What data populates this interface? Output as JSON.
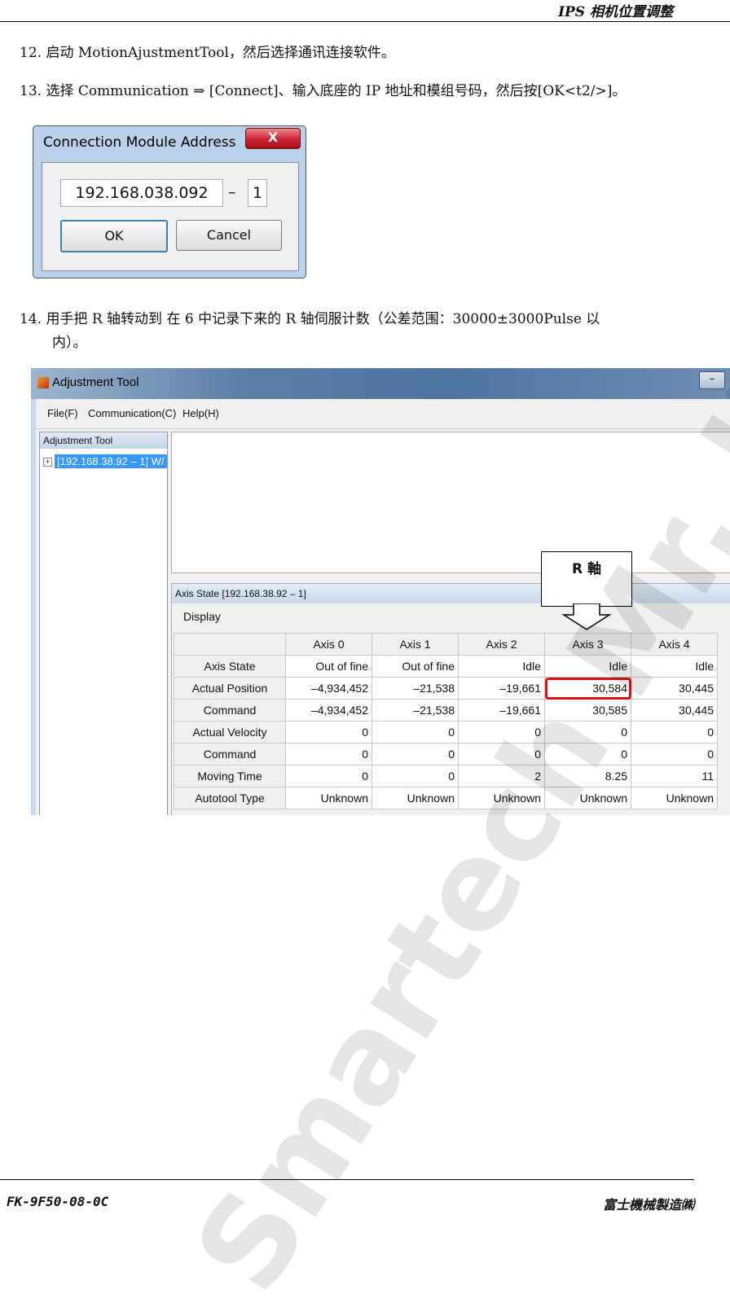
{
  "header": {
    "title": "IPS 相机位置调整"
  },
  "steps": {
    "s12": "12. 启动 MotionAjustmentTool，然后选择通讯连接软件。",
    "s13": "13. 选择 Communication ⇒ [Connect]、输入底座的 IP 地址和模组号码，然后按[OK<t2/>]。",
    "s14_line1": "14. 用手把 R 轴转动到 在 6 中记录下来的 R 轴伺服计数（公差范围：30000±3000Pulse 以",
    "s14_line2": "内）。"
  },
  "dialog": {
    "title": "Connection Module Address",
    "close_glyph": "X",
    "ip_value": "192.168.038.092",
    "dash": "–",
    "module_value": "1",
    "ok_label": "OK",
    "cancel_label": "Cancel"
  },
  "app": {
    "title": "Adjustment Tool",
    "minimize_glyph": "–",
    "menu": [
      "File(F)",
      "Communication(C)",
      "Help(H)"
    ],
    "tree_header": "Adjustment Tool",
    "tree_node": "[192.168.38.92 – 1] W/",
    "axis_pane_header": "Axis State [192.168.38.92 – 1]",
    "display_menu": "Display",
    "columns": [
      "",
      "Axis 0",
      "Axis 1",
      "Axis 2",
      "Axis 3",
      "Axis 4"
    ],
    "rows": [
      [
        "Axis State",
        "Out of fine",
        "Out of fine",
        "Idle",
        "Idle",
        "Idle"
      ],
      [
        "Actual Position",
        "–4,934,452",
        "–21,538",
        "–19,661",
        "30,584",
        "30,445"
      ],
      [
        "Command",
        "–4,934,452",
        "–21,538",
        "–19,661",
        "30,585",
        "30,445"
      ],
      [
        "Actual Velocity",
        "0",
        "0",
        "0",
        "0",
        "0"
      ],
      [
        "Command",
        "0",
        "0",
        "0",
        "0",
        "0"
      ],
      [
        "Moving Time",
        "0",
        "0",
        "2",
        "8.25",
        "11"
      ],
      [
        "Autotool Type",
        "Unknown",
        "Unknown",
        "Unknown",
        "Unknown",
        "Unknown"
      ]
    ],
    "highlight_color": "#e01010"
  },
  "callout": {
    "label": "R 軸"
  },
  "watermark": "Smartech Mr. JF Sun",
  "footer": {
    "left": "FK-9F50-08-0C",
    "right": "富士機械製造㈱"
  }
}
